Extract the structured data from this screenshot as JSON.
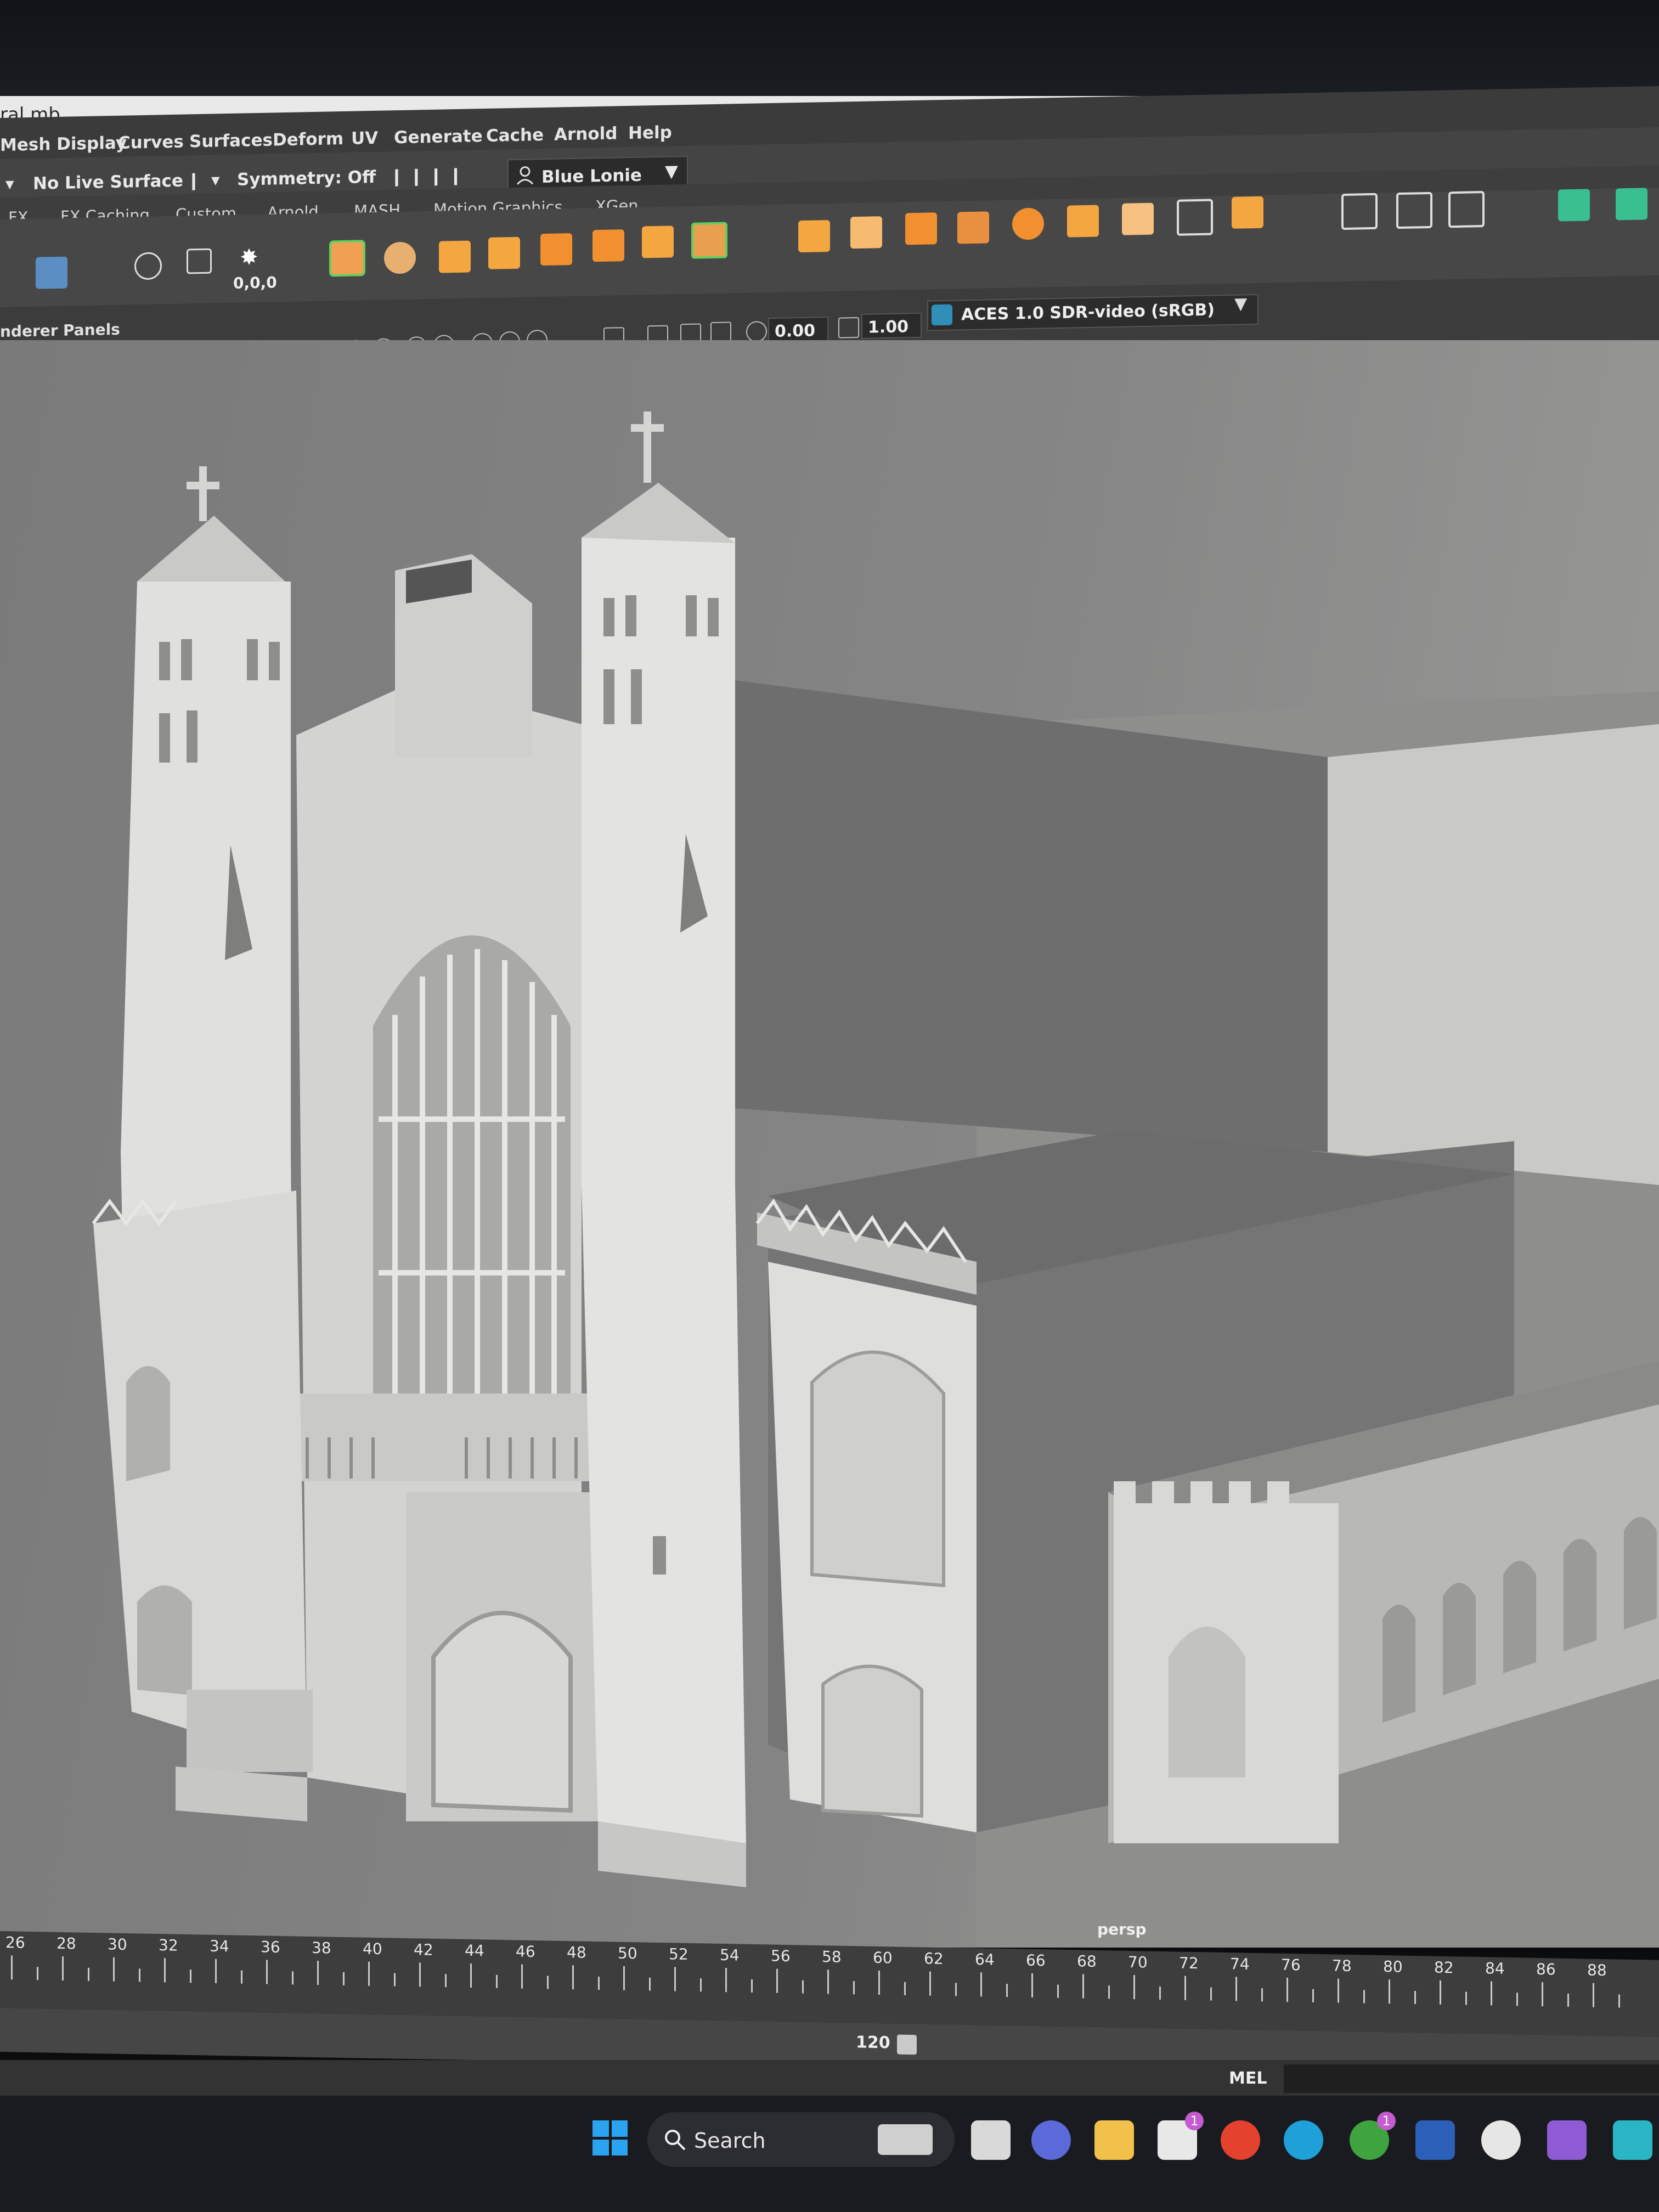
{
  "window": {
    "title": "ral.mb"
  },
  "menu": [
    "Mesh Display",
    "Curves",
    "Surfaces",
    "Deform",
    "UV",
    "Generate",
    "Cache",
    "Arnold",
    "Help"
  ],
  "status_line": {
    "live_surface": "No Live Surface",
    "symmetry": "Symmetry: Off",
    "workspace": "Blue Lonie"
  },
  "shelf_tabs": [
    "FX",
    "FX Caching",
    "Custom",
    "Arnold",
    "MASH",
    "Motion Graphics",
    "XGen"
  ],
  "shelf": {
    "coord_readout": "0,0,0"
  },
  "panel_menu": [
    "nderer",
    "Panels"
  ],
  "viewport_toolbar": {
    "exposure": "0.00",
    "gamma": "1.00",
    "color_space": "ACES 1.0 SDR-video (sRGB)"
  },
  "viewport": {
    "camera": "persp"
  },
  "timeline": {
    "ticks": [
      "26",
      "28",
      "30",
      "32",
      "34",
      "36",
      "38",
      "40",
      "42",
      "44",
      "46",
      "48",
      "50",
      "52",
      "54",
      "56",
      "58",
      "60",
      "62",
      "64",
      "66",
      "68",
      "70",
      "72",
      "74",
      "76",
      "78",
      "80",
      "82",
      "84",
      "86",
      "88"
    ]
  },
  "range": {
    "end": "120"
  },
  "command_line": {
    "language": "MEL"
  },
  "taskbar": {
    "search_label": "Search",
    "badges": {
      "store": "1",
      "xbox": "1"
    },
    "colors": {
      "windows": "#2aa3f0",
      "edge": "#1fa0d8",
      "word": "#2b5fb8",
      "vs": "#8e5bd4",
      "chrome": "#e4412f"
    }
  }
}
